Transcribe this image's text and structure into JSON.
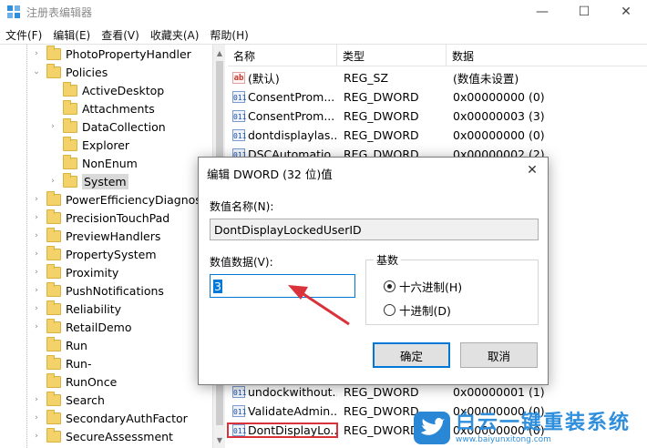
{
  "window": {
    "title": "注册表编辑器",
    "controls": [
      "—",
      "☐",
      "✕"
    ]
  },
  "menu": [
    "文件(F)",
    "编辑(E)",
    "查看(V)",
    "收藏夹(A)",
    "帮助(H)"
  ],
  "tree": [
    {
      "label": "PhotoPropertyHandler",
      "expand": "›",
      "level": 0
    },
    {
      "label": "Policies",
      "expand": "⌄",
      "level": 0
    },
    {
      "label": "ActiveDesktop",
      "expand": "",
      "level": 1
    },
    {
      "label": "Attachments",
      "expand": "",
      "level": 1
    },
    {
      "label": "DataCollection",
      "expand": "›",
      "level": 1
    },
    {
      "label": "Explorer",
      "expand": "",
      "level": 1
    },
    {
      "label": "NonEnum",
      "expand": "",
      "level": 1
    },
    {
      "label": "System",
      "expand": "›",
      "level": 1,
      "selected": true
    },
    {
      "label": "PowerEfficiencyDiagnostic",
      "expand": "›",
      "level": 0
    },
    {
      "label": "PrecisionTouchPad",
      "expand": "›",
      "level": 0
    },
    {
      "label": "PreviewHandlers",
      "expand": "›",
      "level": 0
    },
    {
      "label": "PropertySystem",
      "expand": "›",
      "level": 0
    },
    {
      "label": "Proximity",
      "expand": "›",
      "level": 0
    },
    {
      "label": "PushNotifications",
      "expand": "›",
      "level": 0
    },
    {
      "label": "Reliability",
      "expand": "›",
      "level": 0
    },
    {
      "label": "RetailDemo",
      "expand": "›",
      "level": 0
    },
    {
      "label": "Run",
      "expand": "",
      "level": 0
    },
    {
      "label": "Run-",
      "expand": "",
      "level": 0
    },
    {
      "label": "RunOnce",
      "expand": "",
      "level": 0
    },
    {
      "label": "Search",
      "expand": "›",
      "level": 0
    },
    {
      "label": "SecondaryAuthFactor",
      "expand": "›",
      "level": 0
    },
    {
      "label": "SecureAssessment",
      "expand": "›",
      "level": 0
    }
  ],
  "list": {
    "headers": [
      "名称",
      "类型",
      "数据"
    ],
    "rows": [
      {
        "icon": "ab",
        "name": "(默认)",
        "type": "REG_SZ",
        "data": "(数值未设置)"
      },
      {
        "icon": "bin",
        "name": "ConsentProm...",
        "type": "REG_DWORD",
        "data": "0x00000000 (0)"
      },
      {
        "icon": "bin",
        "name": "ConsentProm...",
        "type": "REG_DWORD",
        "data": "0x00000003 (3)"
      },
      {
        "icon": "bin",
        "name": "dontdisplaylas...",
        "type": "REG_DWORD",
        "data": "0x00000000 (0)"
      },
      {
        "icon": "bin",
        "name": "DSCAutomatio...",
        "type": "REG_DWORD",
        "data": "0x00000002 (2)"
      },
      {
        "icon": "bin",
        "name": "undockwithout...",
        "type": "REG_DWORD",
        "data": "0x00000001 (1)"
      },
      {
        "icon": "bin",
        "name": "ValidateAdmin...",
        "type": "REG_DWORD",
        "data": "0x00000000 (0)"
      },
      {
        "icon": "bin",
        "name": "DontDisplayLo...",
        "type": "REG_DWORD",
        "data": "0x00000000 (0)",
        "highlight": true
      }
    ]
  },
  "dialog": {
    "title": "编辑 DWORD (32 位)值",
    "close": "✕",
    "name_label": "数值名称(N):",
    "name_value": "DontDisplayLockedUserID",
    "data_label": "数值数据(V):",
    "data_value": "3",
    "base_label": "基数",
    "radio_hex": "十六进制(H)",
    "radio_dec": "十进制(D)",
    "ok": "确定",
    "cancel": "取消"
  },
  "watermark": {
    "text": "白云一键重装系统",
    "url": "www.baiyunxitong.com"
  },
  "colors": {
    "accent": "#0078d7",
    "annotation": "#d9323a",
    "watermark": "#2f8fdc"
  }
}
